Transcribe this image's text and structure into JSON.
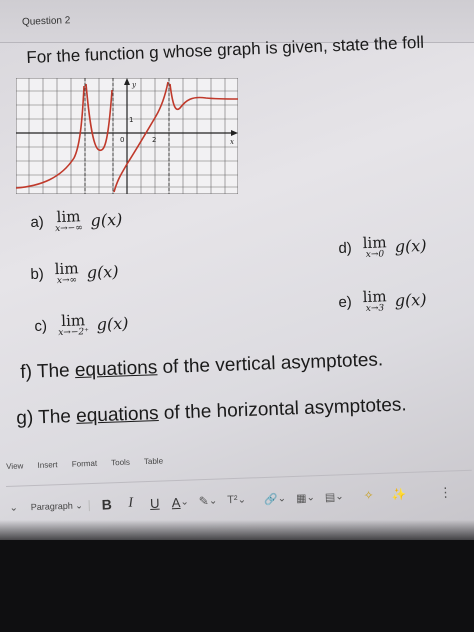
{
  "question": {
    "label": "Question 2",
    "prompt": "For the function g whose graph is given, state the foll"
  },
  "graph": {
    "y_label": "y",
    "x_label": "x",
    "tick_1": "1",
    "tick_0": "0",
    "tick_2": "2"
  },
  "items": [
    {
      "label": "a)",
      "lim": "lim",
      "sub": "x→−∞",
      "fn": "g(x)"
    },
    {
      "label": "b)",
      "lim": "lim",
      "sub": "x→∞",
      "fn": "g(x)"
    },
    {
      "label": "c)",
      "lim": "lim",
      "sub": "x→−2⁺",
      "fn": "g(x)"
    },
    {
      "label": "d)",
      "lim": "lim",
      "sub": "x→0",
      "fn": "g(x)"
    },
    {
      "label": "e)",
      "lim": "lim",
      "sub": "x→3",
      "fn": "g(x)"
    }
  ],
  "questions_text": {
    "f_label": "f)",
    "f_pre": "The ",
    "f_u": "equations",
    "f_post": " of the vertical asymptotes.",
    "g_label": "g)",
    "g_pre": "The ",
    "g_u": "equations",
    "g_post": " of the horizontal asymptotes."
  },
  "menu": [
    "View",
    "Insert",
    "Format",
    "Tools",
    "Table"
  ],
  "toolbar": {
    "paragraph": "Paragraph",
    "bold": "B",
    "italic": "I",
    "underline": "U",
    "font_color": "A",
    "superscript": "T²"
  },
  "colors": {
    "curve": "#c0392b",
    "grid": "#6a6a6a"
  }
}
